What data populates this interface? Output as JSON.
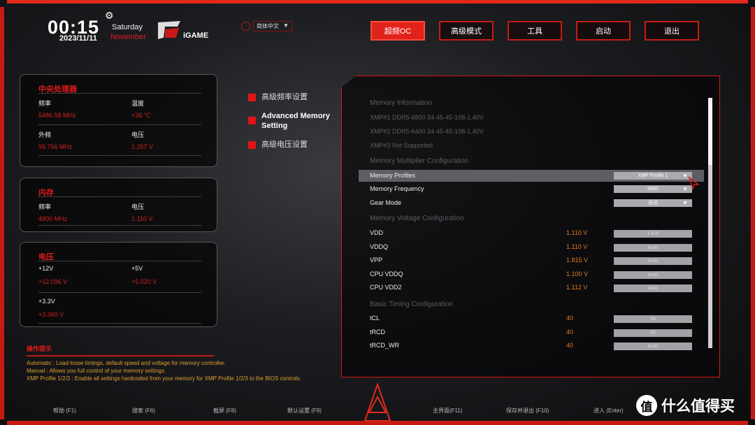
{
  "header": {
    "time": "00:15",
    "date": "2023/11/11",
    "weekday": "Saturday",
    "month": "November",
    "brand": "iGAME",
    "language": "简体中文"
  },
  "nav": [
    {
      "label": "超频OC",
      "active": true
    },
    {
      "label": "高级模式"
    },
    {
      "label": "工具"
    },
    {
      "label": "启动"
    },
    {
      "label": "退出"
    }
  ],
  "cpu": {
    "title": "中央处理器",
    "freq_label": "频率",
    "freq": "5486.58 MHz",
    "temp_label": "温度",
    "temp": "+36 °C",
    "bclk_label": "外频",
    "bclk": "99.756 MHz",
    "volt_label": "电压",
    "volt": "1.257 V"
  },
  "memory": {
    "title": "内存",
    "freq_label": "频率",
    "freq": "4800 MHz",
    "volt_label": "电压",
    "volt": "1.110 V"
  },
  "voltage": {
    "title": "电压",
    "v12_label": "+12V",
    "v12": "+12.096 V",
    "v5_label": "+5V",
    "v5": "+5.020 V",
    "v33_label": "+3.3V",
    "v33": "+3.360 V"
  },
  "submenu": [
    "高级频率设置",
    "Advanced Memory Setting",
    "高级电压设置"
  ],
  "settings": {
    "mem_info": "Memory Information",
    "xmp1": "XMP#1 DDR5-6800 34-45-45-108-1.40V",
    "xmp2": "XMP#2 DDR5-6400 34-45-45-108-1.40V",
    "xmp3": "XMP#3 Not Supported",
    "mult_sec": "Memory Multiplier Configuration",
    "profiles": {
      "label": "Memory Profiles",
      "value": "XMP Profile 1"
    },
    "frequency": {
      "label": "Memory Frequency",
      "value": "6800"
    },
    "gear": {
      "label": "Gear Mode",
      "value": "自动"
    },
    "volt_sec": "Memory Voltage Configuration",
    "volts": [
      {
        "label": "VDD",
        "current": "1.110 V",
        "value": "1.400"
      },
      {
        "label": "VDDQ",
        "current": "1.110 V",
        "value": "Auto"
      },
      {
        "label": "VPP",
        "current": "1.815 V",
        "value": "Auto"
      },
      {
        "label": "CPU VDDQ",
        "current": "1.100 V",
        "value": "Auto"
      },
      {
        "label": "CPU VDD2",
        "current": "1.112 V",
        "value": "Auto"
      }
    ],
    "timing_sec": "Basic Timing Configuration",
    "timings": [
      {
        "label": "tCL",
        "current": "40",
        "value": "34"
      },
      {
        "label": "tRCD",
        "current": "40",
        "value": "45"
      },
      {
        "label": "tRCD_WR",
        "current": "40",
        "value": "Auto"
      }
    ]
  },
  "tips": {
    "title": "操作提示",
    "lines": [
      "Automatic : Load loose timings, default speed and voltage for memory controller.",
      "Manual : Allows you full control of your memory settings.",
      "XMP Profile 1/2/3 : Enable all settings hardcoded from your memory for XMP Profile 1/2/3 to the BIOS controls."
    ]
  },
  "footer": [
    "帮助 (F1)",
    "搜索 (F6)",
    "截屏 (F8)",
    "默认设置 (F9)",
    "主界面(F11)",
    "保存并退出 (F10)",
    "进入 (Enter)"
  ],
  "watermark": {
    "glyph": "值",
    "text": "什么值得买"
  },
  "colors": {
    "accent": "#e0231a",
    "value": "#e07a20"
  }
}
